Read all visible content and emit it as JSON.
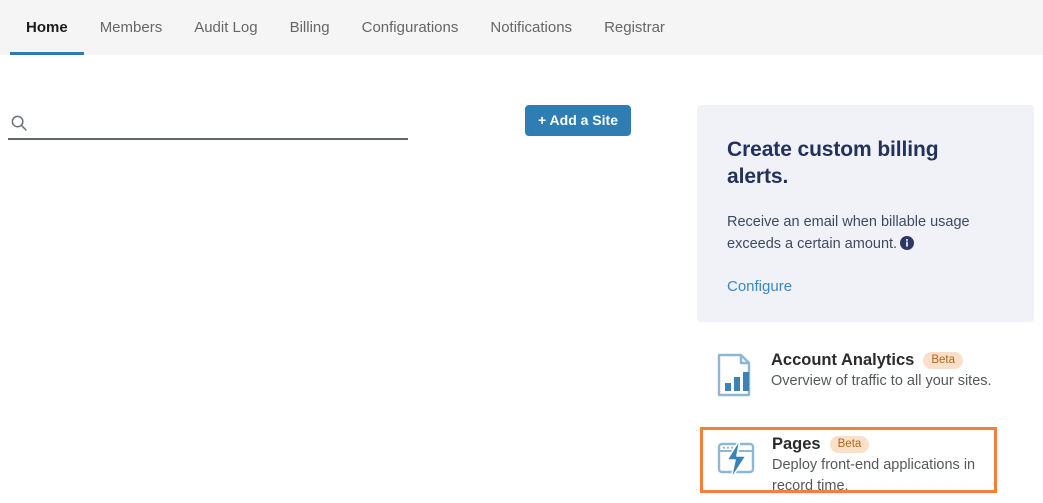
{
  "tabs": [
    {
      "label": "Home",
      "active": true
    },
    {
      "label": "Members",
      "active": false
    },
    {
      "label": "Audit Log",
      "active": false
    },
    {
      "label": "Billing",
      "active": false
    },
    {
      "label": "Configurations",
      "active": false
    },
    {
      "label": "Notifications",
      "active": false
    },
    {
      "label": "Registrar",
      "active": false
    }
  ],
  "toolbar": {
    "search": {
      "icon": "search-icon",
      "value": "",
      "placeholder": ""
    },
    "add_site_label": "+ Add a Site"
  },
  "billing_card": {
    "title": "Create custom billing alerts.",
    "body": "Receive an email when billable usage exceeds a certain amount.",
    "info_icon": "info-circle-icon",
    "link_label": "Configure"
  },
  "features": [
    {
      "icon": "document-bar-chart-icon",
      "title": "Account Analytics",
      "badge": "Beta",
      "description": "Overview of traffic to all your sites.",
      "highlighted": false
    },
    {
      "icon": "browser-lightning-icon",
      "title": "Pages",
      "badge": "Beta",
      "description": "Deploy front-end applications in record time.",
      "highlighted": true
    }
  ],
  "colors": {
    "accent_blue": "#2f7eb3",
    "active_tab_underline": "#2c7cb0",
    "tabbar_bg": "#f5f5f5",
    "card_bg": "#f1f2f7",
    "card_title": "#22325b",
    "link_blue": "#3b87c4",
    "badge_bg": "#fae0c8",
    "badge_text": "#b5651d",
    "highlight_border": "#f4803b",
    "icon_blue": "#3b82b5"
  }
}
